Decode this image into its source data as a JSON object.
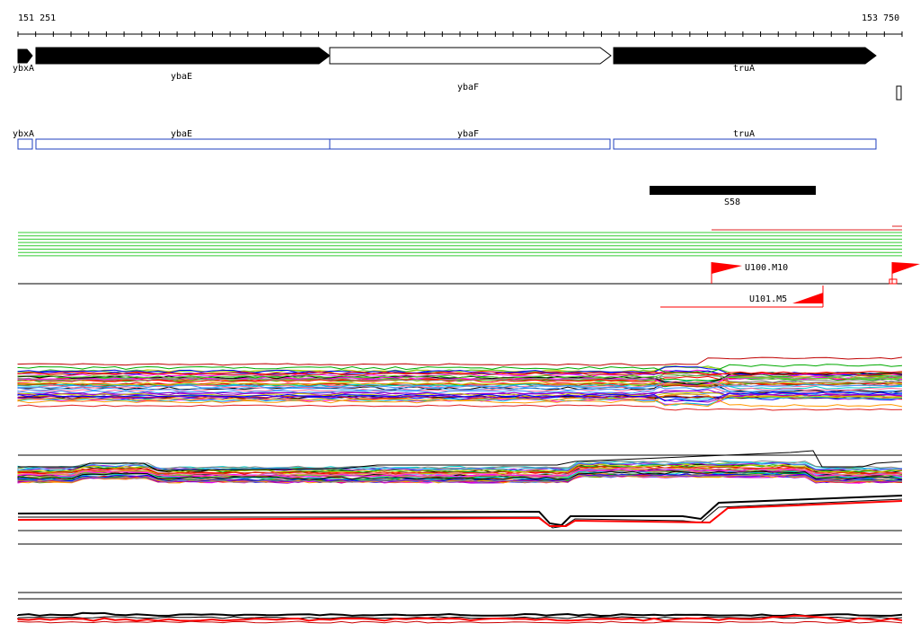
{
  "ruler": {
    "start": "151 251",
    "end": "153 750"
  },
  "genes": [
    {
      "name": "ybxA",
      "strand": "+",
      "filled": true
    },
    {
      "name": "ybaE",
      "strand": "+",
      "filled": true
    },
    {
      "name": "ybaF",
      "strand": "+",
      "filled": false
    },
    {
      "name": "truA",
      "strand": "+",
      "filled": true
    }
  ],
  "transcripts": [
    {
      "name": "ybxA"
    },
    {
      "name": "ybaE"
    },
    {
      "name": "ybaF"
    },
    {
      "name": "truA"
    }
  ],
  "feature": {
    "name": "S58"
  },
  "promoters": [
    {
      "name": "U100.M10"
    },
    {
      "name": "U101.M5"
    }
  ],
  "colors": {
    "gene_fill": "#000000",
    "transcript_stroke": "#1f3fbf",
    "flag": "#ff0000",
    "green_tracks": "#33cc33",
    "baseline": "#000000"
  }
}
